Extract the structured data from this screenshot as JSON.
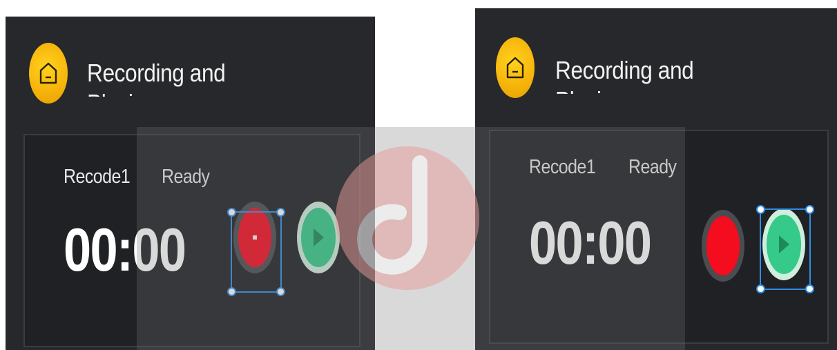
{
  "panels": [
    {
      "title": "Recording and Playing",
      "record_name": "Recode1",
      "status": "Ready",
      "timer": "00:00",
      "selected_control": "record"
    },
    {
      "title": "Recording and Playing",
      "record_name": "Recode1",
      "status": "Ready",
      "timer": "00:00",
      "selected_control": "play"
    }
  ],
  "colors": {
    "panel_bg": "#26282b",
    "card_bg": "#1f2124",
    "accent_yellow": "#f7b50c",
    "record_red": "#f40c1f",
    "play_green": "#35c98a",
    "selection_blue": "#2f8ee6"
  },
  "icons": {
    "header": "home-icon",
    "record": "record-icon",
    "play": "play-icon"
  }
}
